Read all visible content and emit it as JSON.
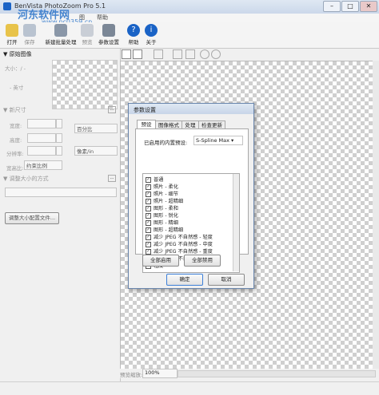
{
  "window": {
    "title": "BenVista PhotoZoom Pro 5.1"
  },
  "watermark": {
    "line1": "河东软件网",
    "line2": "www.pc0359.cn"
  },
  "menu": [
    "帮助",
    "图"
  ],
  "toolbar": {
    "items": [
      {
        "label": "打开",
        "icon": "open-folder-icon"
      },
      {
        "label": "保存",
        "icon": "save-icon"
      },
      {
        "label": "新建批量处理",
        "icon": "batch-icon"
      },
      {
        "label": "预览",
        "icon": "preview-icon"
      },
      {
        "label": "参数设置",
        "icon": "settings-icon"
      },
      {
        "label": "帮助",
        "icon": "help-icon"
      },
      {
        "label": "关于",
        "icon": "about-icon"
      }
    ],
    "colors": {
      "help": "#1a63c6",
      "about": "#1a63c6"
    }
  },
  "left": {
    "source_header": "原始图像",
    "size_label": "大小：/ -",
    "ppi_label": "- 英寸",
    "newsize_header": "新尺寸",
    "width_label": "宽度:",
    "height_label": "高度:",
    "resolution_label": "分辨率:",
    "unit_percent": "百分比",
    "unit_ppi": "像素/in",
    "ratio_label": "宽高比:",
    "ratio_value": "约束比例",
    "resize_header": "调整大小的方式",
    "profile_button": "调整大小配置文件..."
  },
  "bottom": {
    "zoom_label": "预览缩放:",
    "zoom_value": "100%"
  },
  "dialog": {
    "title": "参数设置",
    "tabs": [
      "预设",
      "图像格式",
      "处理",
      "检查更新"
    ],
    "preset_label": "已启用的内置预设:",
    "preset_value": "S-Spline Max",
    "items": [
      "普通",
      "照片 - 柔化",
      "照片 - 细节",
      "照片 - 超精细",
      "图形 - 柔和",
      "图形 - 锐化",
      "图形 - 精细",
      "图形 - 超精细",
      "减少 JPEG 不自然感 - 轻度",
      "减少 JPEG 不自然感 - 中度",
      "减少 JPEG 不自然感 - 重度",
      "减少 JPEG 不自然感 - 极度",
      "粗度"
    ],
    "enable_all": "全部启用",
    "disable_all": "全部禁用",
    "ok": "确定",
    "cancel": "取消"
  }
}
